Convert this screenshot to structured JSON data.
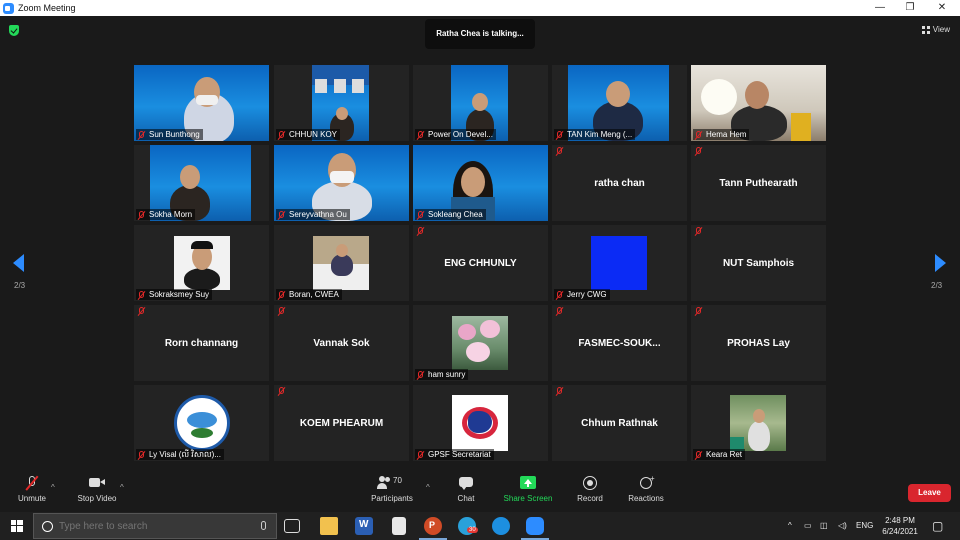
{
  "window": {
    "title": "Zoom Meeting",
    "minimize": "—",
    "maximize": "❐",
    "close": "✕"
  },
  "meeting": {
    "talking": "Ratha Chea is talking...",
    "view_label": "View",
    "page_left": "2/3",
    "page_right": "2/3"
  },
  "tiles": [
    {
      "name": "Sun Bunthong"
    },
    {
      "name": "CHHUN KOY"
    },
    {
      "name": "Power On Devel..."
    },
    {
      "name": "TAN Kim Meng (..."
    },
    {
      "name": "Hema Hem"
    },
    {
      "name": "Sokha Morn"
    },
    {
      "name": "Sereyvathna Ou"
    },
    {
      "name": "Sokleang Chea"
    },
    {
      "name": "ratha chan"
    },
    {
      "name": "Tann Puthearath"
    },
    {
      "name": "Sokraksmey Suy"
    },
    {
      "name": "Boran, CWEA"
    },
    {
      "name": "ENG CHHUNLY"
    },
    {
      "name": "Jerry CWG"
    },
    {
      "name": "NUT Samphois"
    },
    {
      "name": "Rorn channang"
    },
    {
      "name": "Vannak Sok"
    },
    {
      "name": "ham sunry"
    },
    {
      "name": "FASMEC-SOUK..."
    },
    {
      "name": "PROHAS Lay"
    },
    {
      "name": "Ly Visal (លី វិសាល)..."
    },
    {
      "name": "KOEM PHEARUM"
    },
    {
      "name": "GPSF Secretariat"
    },
    {
      "name": "Chhum Rathnak"
    },
    {
      "name": "Keara Ret"
    }
  ],
  "toolbar": {
    "unmute": "Unmute",
    "stop_video": "Stop Video",
    "participants": "Participants",
    "participants_count": "70",
    "chat": "Chat",
    "share_screen": "Share Screen",
    "record": "Record",
    "reactions": "Reactions",
    "leave": "Leave",
    "share_color": "#23d959",
    "leave_color": "#d9262e"
  },
  "taskbar": {
    "search_placeholder": "Type here to search",
    "telegram_badge": "30",
    "language": "ENG",
    "time": "2:48 PM",
    "date": "6/24/2021"
  }
}
